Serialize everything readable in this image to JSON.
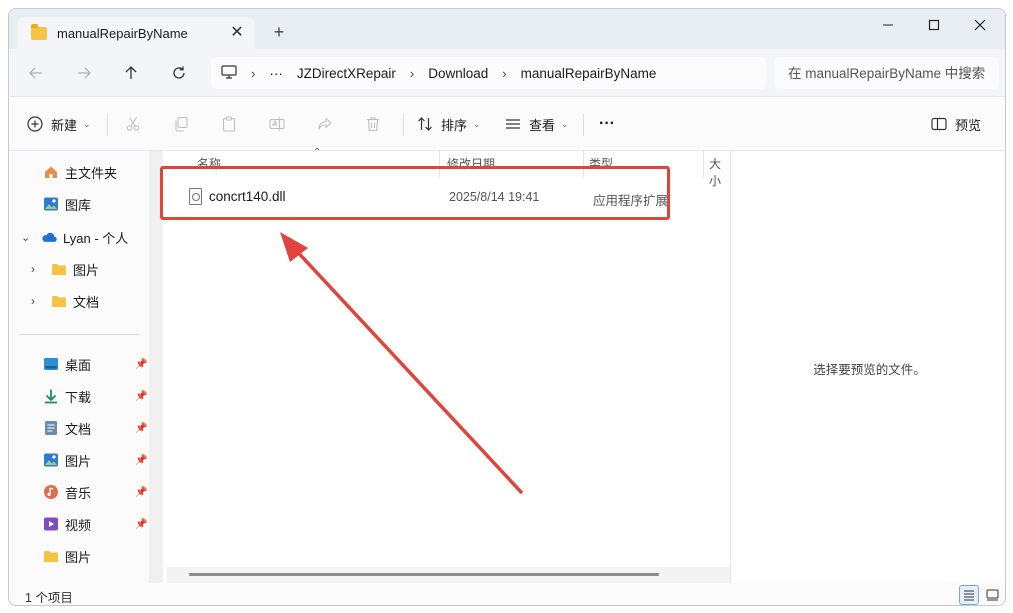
{
  "window": {
    "tab_title": "manualRepairByName",
    "new_tab_symbol": "+",
    "tab_close_symbol": "✕"
  },
  "address_bar": {
    "ellipsis": "···",
    "segments": [
      "JZDirectXRepair",
      "Download",
      "manualRepairByName"
    ]
  },
  "search": {
    "placeholder": "在 manualRepairByName 中搜索"
  },
  "toolbar": {
    "new_label": "新建",
    "sort_label": "排序",
    "view_label": "查看",
    "more_label": "···",
    "preview_label": "预览"
  },
  "sidebar": {
    "items": [
      {
        "label": "主文件夹",
        "icon": "home-icon"
      },
      {
        "label": "图库",
        "icon": "gallery-icon"
      },
      {
        "label": "Lyan - 个人",
        "icon": "onedrive-cloud-icon"
      },
      {
        "label": "图片",
        "icon": "folder-icon"
      },
      {
        "label": "文档",
        "icon": "folder-icon"
      },
      {
        "label": "桌面",
        "icon": "desktop-icon"
      },
      {
        "label": "下载",
        "icon": "download-icon"
      },
      {
        "label": "文档",
        "icon": "document-icon"
      },
      {
        "label": "图片",
        "icon": "pictures-icon"
      },
      {
        "label": "音乐",
        "icon": "music-icon"
      },
      {
        "label": "视频",
        "icon": "video-icon"
      },
      {
        "label": "图片",
        "icon": "folder-icon"
      }
    ]
  },
  "file_list": {
    "columns": [
      "名称",
      "修改日期",
      "类型",
      "大小"
    ],
    "rows": [
      {
        "name": "concrt140.dll",
        "modified": "2025/8/14 19:41",
        "type": "应用程序扩展"
      }
    ]
  },
  "preview": {
    "message": "选择要预览的文件。"
  },
  "status": {
    "count": "1 个项目"
  },
  "colors": {
    "highlight": "#e0443c",
    "accent": "#0067c0",
    "folder": "#f6c344"
  }
}
